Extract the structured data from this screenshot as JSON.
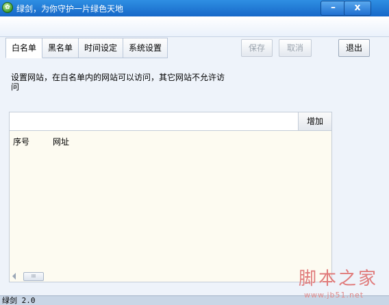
{
  "window": {
    "title": "绿剑，为你守护一片绿色天地",
    "minimize_glyph": "–",
    "close_glyph": "x",
    "icon": "green-sword-app-icon"
  },
  "tabs": [
    {
      "label": "白名单",
      "active": true
    },
    {
      "label": "黑名单",
      "active": false
    },
    {
      "label": "时间设定",
      "active": false
    },
    {
      "label": "系统设置",
      "active": false
    }
  ],
  "toolbar": {
    "save_label": "保存",
    "cancel_label": "取消",
    "exit_label": "退出"
  },
  "whitelist": {
    "description": "设置网站，在白名单内的网站可以访问，其它网站不允许访问",
    "url_input_value": "",
    "add_label": "增加",
    "columns": [
      "序号",
      "网址"
    ],
    "rows": []
  },
  "scrollbar": {
    "thumb_glyph": "III"
  },
  "status": {
    "version_text": "绿剑 2.0"
  },
  "watermark": {
    "text": "脚本之家",
    "url": "www.jb51.net"
  },
  "colors": {
    "titlebar": "#1f6fd0",
    "background": "#eef3fa",
    "list_background": "#fdfbf1",
    "watermark": "#e07a7a"
  }
}
